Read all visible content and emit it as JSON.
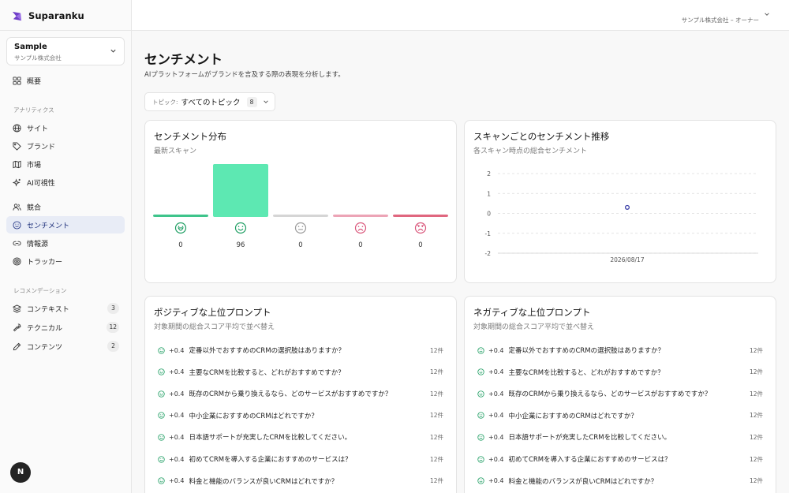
{
  "app": {
    "name": "Suparanku"
  },
  "org": {
    "name": "Sample",
    "sub": "サンプル株式会社"
  },
  "account": "サンプル株式会社 – オーナー",
  "nav": {
    "overview": "概要",
    "section_analytics": "アナリティクス",
    "site": "サイト",
    "brand": "ブランド",
    "market": "市場",
    "ai": "AI可視性",
    "competitors": "競合",
    "sentiment": "センチメント",
    "sources": "情報源",
    "tracker": "トラッカー",
    "section_reco": "レコメンデーション",
    "context": "コンテキスト",
    "context_badge": "3",
    "technical": "テクニカル",
    "technical_badge": "12",
    "content": "コンテンツ",
    "content_badge": "2"
  },
  "avatar": "N",
  "page": {
    "title": "センチメント",
    "description": "AIプラットフォームがブランドを言及する際の表現を分析します。"
  },
  "filter": {
    "label": "トピック:",
    "value": "すべてのトピック",
    "count": "8"
  },
  "dist_card": {
    "title": "センチメント分布",
    "subtitle": "最新スキャン"
  },
  "trend_card": {
    "title": "スキャンごとのセンチメント推移",
    "subtitle": "各スキャン時点の総合センチメント"
  },
  "positive_card": {
    "title": "ポジティブな上位プロンプト",
    "subtitle": "対象期間の総合スコア平均で並べ替え"
  },
  "negative_card": {
    "title": "ネガティブな上位プロンプト",
    "subtitle": "対象期間の総合スコア平均で並べ替え"
  },
  "chart_data": [
    {
      "type": "bar",
      "categories": [
        "very-positive",
        "positive",
        "neutral",
        "negative",
        "very-negative"
      ],
      "values": [
        0,
        96,
        0,
        0,
        0
      ],
      "colors": [
        "#3ec48b",
        "#5de8b2",
        "#d5d5d5",
        "#eca4b6",
        "#e0677f"
      ],
      "icons": [
        "grin-face-icon",
        "smile-face-icon",
        "neutral-face-icon",
        "frown-face-icon",
        "angry-face-icon"
      ],
      "icon_colors": [
        "#1f9e63",
        "#1f9e63",
        "#9a9a9a",
        "#d9557a",
        "#d9557a"
      ],
      "labels": [
        "0",
        "96",
        "0",
        "0",
        "0"
      ],
      "ylim": [
        0,
        96
      ]
    },
    {
      "type": "scatter",
      "x": [
        "2026/08/17"
      ],
      "y": [
        0.3
      ],
      "yticks": [
        "2",
        "1",
        "0",
        "-1",
        "-2"
      ],
      "ylim": [
        -2,
        2
      ],
      "grid": true,
      "color": "#3b3fa8"
    }
  ],
  "positive_prompts": [
    {
      "score": "+0.4",
      "text": "定番以外でおすすめのCRMの選択肢はありますか？",
      "count": "12件"
    },
    {
      "score": "+0.4",
      "text": "主要なCRMを比較すると、どれがおすすめですか？",
      "count": "12件"
    },
    {
      "score": "+0.4",
      "text": "既存のCRMから乗り換えるなら、どのサービスがおすすめですか？",
      "count": "12件"
    },
    {
      "score": "+0.4",
      "text": "中小企業におすすめのCRMはどれですか？",
      "count": "12件"
    },
    {
      "score": "+0.4",
      "text": "日本語サポートが充実したCRMを比較してください。",
      "count": "12件"
    },
    {
      "score": "+0.4",
      "text": "初めてCRMを導入する企業におすすめのサービスは？",
      "count": "12件"
    },
    {
      "score": "+0.4",
      "text": "料金と機能のバランスが良いCRMはどれですか？",
      "count": "12件"
    }
  ],
  "negative_prompts": [
    {
      "score": "+0.4",
      "text": "定番以外でおすすめのCRMの選択肢はありますか？",
      "count": "12件"
    },
    {
      "score": "+0.4",
      "text": "主要なCRMを比較すると、どれがおすすめですか？",
      "count": "12件"
    },
    {
      "score": "+0.4",
      "text": "既存のCRMから乗り換えるなら、どのサービスがおすすめですか？",
      "count": "12件"
    },
    {
      "score": "+0.4",
      "text": "中小企業におすすめのCRMはどれですか？",
      "count": "12件"
    },
    {
      "score": "+0.4",
      "text": "日本語サポートが充実したCRMを比較してください。",
      "count": "12件"
    },
    {
      "score": "+0.4",
      "text": "初めてCRMを導入する企業におすすめのサービスは？",
      "count": "12件"
    },
    {
      "score": "+0.4",
      "text": "料金と機能のバランスが良いCRMはどれですか？",
      "count": "12件"
    }
  ]
}
